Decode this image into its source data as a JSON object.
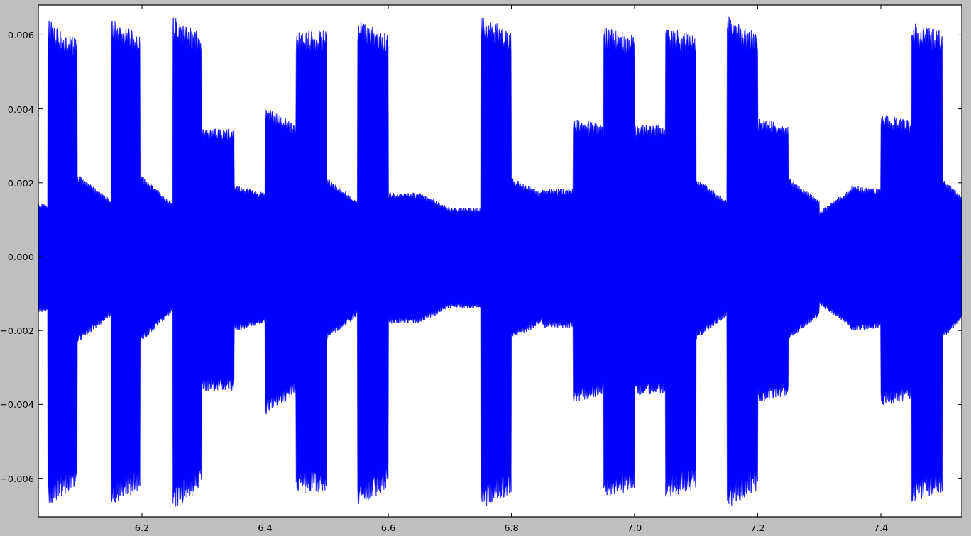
{
  "plot": {
    "xticks": [
      "6.2",
      "6.4",
      "6.6",
      "6.8",
      "7.0",
      "7.2",
      "7.4"
    ],
    "yticks": [
      "0.006",
      "0.004",
      "0.002",
      "0.000",
      "−0.002",
      "−0.004",
      "−0.006"
    ]
  }
}
